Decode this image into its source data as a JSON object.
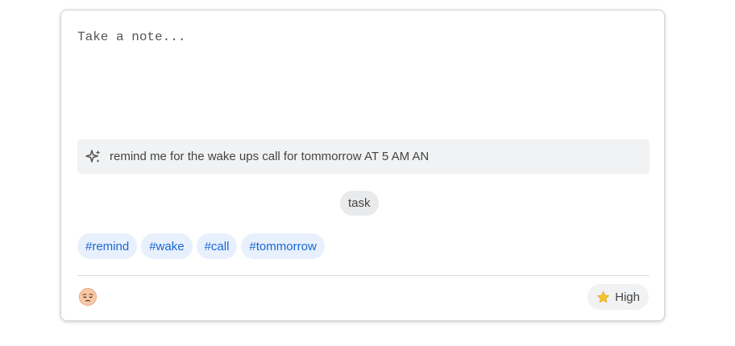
{
  "note": {
    "placeholder": "Take a note...",
    "value": ""
  },
  "ai_suggestion": {
    "icon": "sparkle-icon",
    "text": "remind me for the wake ups call for tommorrow AT 5 AM AN"
  },
  "category": {
    "label": "task"
  },
  "tags": [
    "#remind",
    "#wake",
    "#call",
    "#tommorrow"
  ],
  "footer": {
    "mood_icon": "pensive-face-icon",
    "priority": {
      "icon": "star-icon",
      "label": "High"
    }
  },
  "colors": {
    "tag_text": "#1a66d2",
    "tag_background": "#e8f0fd",
    "chip_background": "#e9eaeb",
    "ai_bar_background": "#f1f2f3",
    "star": "#f4c430"
  }
}
